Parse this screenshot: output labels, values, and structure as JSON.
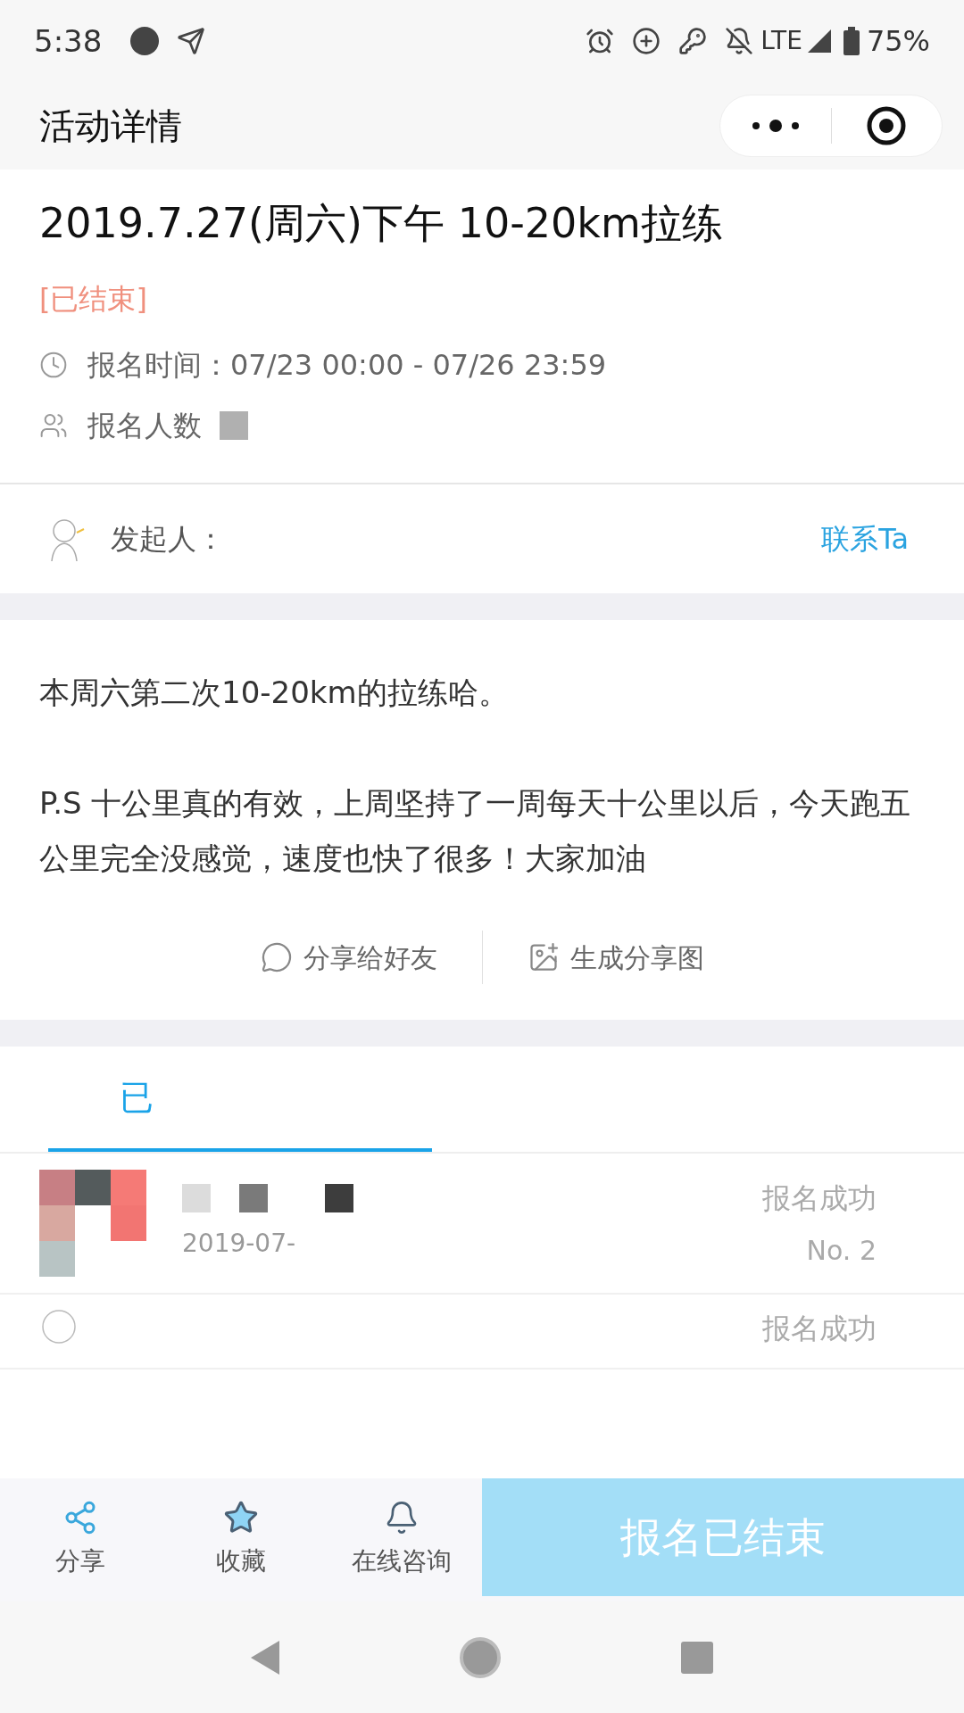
{
  "status_bar": {
    "time": "5:38",
    "network": "LTE",
    "battery": "75%"
  },
  "nav": {
    "title": "活动详情"
  },
  "event": {
    "title": "2019.7.27(周六)下午 10-20km拉练",
    "status": "[已结束]",
    "signup_time_label": "报名时间：",
    "signup_time": "07/23 00:00 - 07/26 23:59",
    "signup_count_label": "报名人数"
  },
  "organizer": {
    "label": "发起人：",
    "contact": "联系Ta"
  },
  "description": [
    "本周六第二次10-20km的拉练哈。",
    "P.S 十公里真的有效，上周坚持了一周每天十公里以后，今天跑五公里完全没感觉，速度也快了很多！大家加油"
  ],
  "share_actions": [
    {
      "kind": "friends",
      "label": "分享给好友"
    },
    {
      "kind": "image",
      "label": "生成分享图"
    }
  ],
  "tabs": [
    {
      "label": "已",
      "selected": true
    }
  ],
  "participants": [
    {
      "date": "2019-07-",
      "status": "报名成功",
      "number": "No. 2"
    },
    {
      "status": "报名成功"
    }
  ],
  "bottom_bar": {
    "actions": [
      {
        "kind": "share",
        "label": "分享"
      },
      {
        "kind": "favorite",
        "label": "收藏"
      },
      {
        "kind": "consult",
        "label": "在线咨询"
      }
    ],
    "signup_button": {
      "label": "报名已结束",
      "disabled": true
    }
  }
}
